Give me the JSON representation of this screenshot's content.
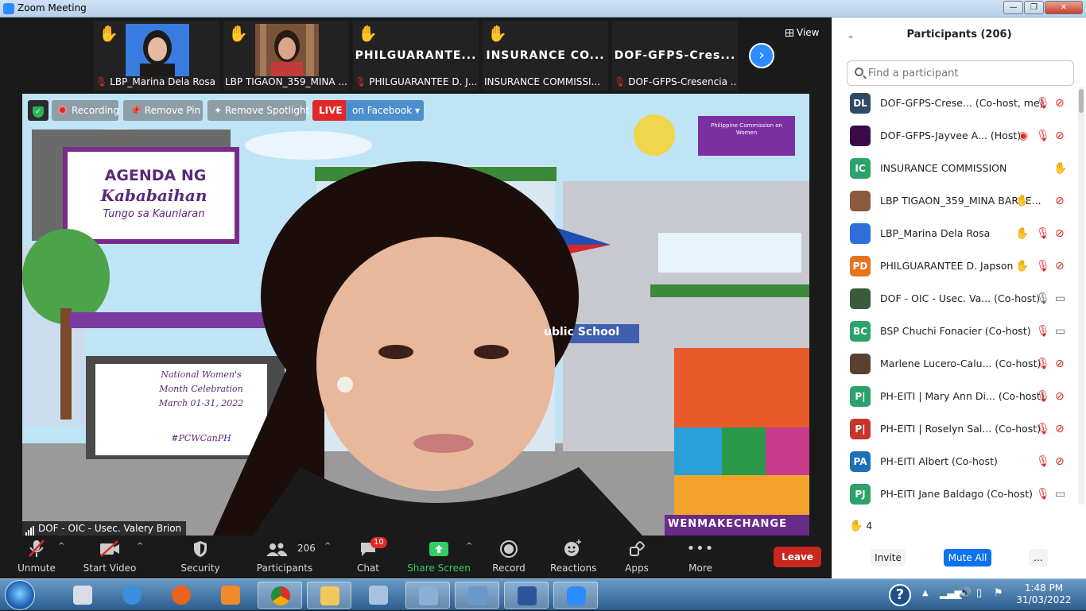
{
  "window": {
    "title": "Zoom Meeting"
  },
  "view_label": "View",
  "strip": [
    {
      "caption": "LBP_Marina Dela Rosa",
      "big": "",
      "muted": true,
      "photo_colors": [
        "#2f6fd8",
        "#1d1a1a"
      ]
    },
    {
      "caption": "LBP TIGAON_359_MINA ...",
      "big": "",
      "muted": false,
      "photo_colors": [
        "#9a6a4a",
        "#2a1a14"
      ]
    },
    {
      "caption": "PHILGUARANTEE D. J...",
      "big": "PHILGUARANTE...",
      "muted": true
    },
    {
      "caption": "INSURANCE COMMISSI...",
      "big": "INSURANCE  CO...",
      "muted": false
    },
    {
      "caption": "DOF-GFPS-Cresencia ...",
      "big": "DOF-GFPS-Cres...",
      "muted": true
    }
  ],
  "badges": {
    "recording": "Recording",
    "remove_pin": "Remove Pin",
    "remove_spotlight": "Remove Spotlight",
    "live": "LIVE",
    "live_target": "on Facebook"
  },
  "video": {
    "speaker": "DOF - OIC - Usec. Valery Brion",
    "sign_title": "AGENDA NG",
    "sign_sub1": "Kababaihan",
    "sign_sub2": "Tungo sa Kaunlaran",
    "board_l1": "National Women's",
    "board_l2": "Month Celebration",
    "board_l3": "March 01-31, 2022",
    "board_tag": "#PCWCanPH",
    "school": "ublic School",
    "hashtag": "WENMAKECHANGE",
    "logo_text": "Philippine Commission on Women"
  },
  "toolbar": {
    "unmute": "Unmute",
    "start_video": "Start Video",
    "security": "Security",
    "participants": "Participants",
    "participants_count": "206",
    "chat": "Chat",
    "chat_badge": "10",
    "share": "Share Screen",
    "record": "Record",
    "reactions": "Reactions",
    "apps": "Apps",
    "more": "More",
    "leave": "Leave"
  },
  "panel": {
    "title": "Participants (206)",
    "search_placeholder": "Find a participant",
    "raised_count": "4",
    "invite": "Invite",
    "mute_all": "Mute All",
    "more": "..."
  },
  "participants": [
    {
      "initials": "DL",
      "color": "#2e4a66",
      "name": "DOF-GFPS-Crese...  (Co-host, me)",
      "hand": false,
      "mic": "muted",
      "video": "off"
    },
    {
      "initials": "",
      "color": "#3a0a4a",
      "name": "DOF-GFPS-Jayvee A...  (Host)",
      "hand": false,
      "mic": "recording",
      "video": "off"
    },
    {
      "initials": "IC",
      "color": "#2ba36a",
      "name": "INSURANCE COMMISSION",
      "hand": true,
      "mic": "none",
      "video": "none"
    },
    {
      "initials": "",
      "color": "#8a5a3a",
      "name": "LBP TIGAON_359_MINA BARRE...",
      "hand": true,
      "mic": "none",
      "video": "off"
    },
    {
      "initials": "",
      "color": "#2f6fd8",
      "name": "LBP_Marina Dela Rosa",
      "hand": true,
      "mic": "muted",
      "video": "off"
    },
    {
      "initials": "PD",
      "color": "#e8731c",
      "name": "PHILGUARANTEE D. Japson",
      "hand": true,
      "mic": "muted",
      "video": "off"
    },
    {
      "initials": "",
      "color": "#3a5a3a",
      "name": "DOF - OIC - Usec. Va...  (Co-host)",
      "hand": false,
      "mic": "on",
      "video": "on"
    },
    {
      "initials": "BC",
      "color": "#2ba36a",
      "name": "BSP Chuchi Fonacier (Co-host)",
      "hand": false,
      "mic": "muted",
      "video": "on"
    },
    {
      "initials": "",
      "color": "#5a4030",
      "name": "Marlene Lucero-Calu...  (Co-host)",
      "hand": false,
      "mic": "muted",
      "video": "off"
    },
    {
      "initials": "P|",
      "color": "#2ba36a",
      "name": "PH-EITI | Mary Ann Di...  (Co-host)",
      "hand": false,
      "mic": "muted",
      "video": "off"
    },
    {
      "initials": "P|",
      "color": "#c8342a",
      "name": "PH-EITI | Roselyn Sal...  (Co-host)",
      "hand": false,
      "mic": "muted",
      "video": "off"
    },
    {
      "initials": "PA",
      "color": "#1d6fb8",
      "name": "PH-EITI Albert (Co-host)",
      "hand": false,
      "mic": "muted",
      "video": "off"
    },
    {
      "initials": "PJ",
      "color": "#2ba36a",
      "name": "PH-EITI Jane Baldago (Co-host)",
      "hand": false,
      "mic": "muted",
      "video": "on"
    }
  ],
  "clock": {
    "time": "1:48 PM",
    "date": "31/03/2022"
  },
  "colors": {
    "accent": "#2d8cff",
    "leave": "#c8281e",
    "share": "#33cc66",
    "muted": "#e02828",
    "hand": "#f2c200"
  }
}
